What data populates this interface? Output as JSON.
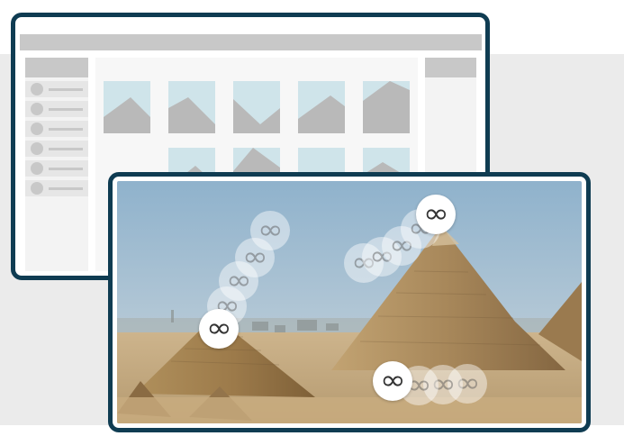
{
  "icons": {
    "marker_symbol": "∞",
    "marker_icon_name": "infinity-icon"
  },
  "colors": {
    "frame": "#0f3c52",
    "placeholder_grey": "#c8c8c8",
    "thumb_sky": "#cfe4ea",
    "page_band": "#ebebeb"
  },
  "back_window": {
    "sidebar_rows": 6,
    "thumbnail_rows": 2,
    "thumbnails_per_row": 5
  },
  "front_window": {
    "image_subject": "pyramids photo",
    "marker_trails": [
      {
        "trail": "left-pyramid",
        "steps": 5
      },
      {
        "trail": "right-pyramid",
        "steps": 5
      },
      {
        "trail": "ground",
        "steps": 4
      }
    ]
  }
}
